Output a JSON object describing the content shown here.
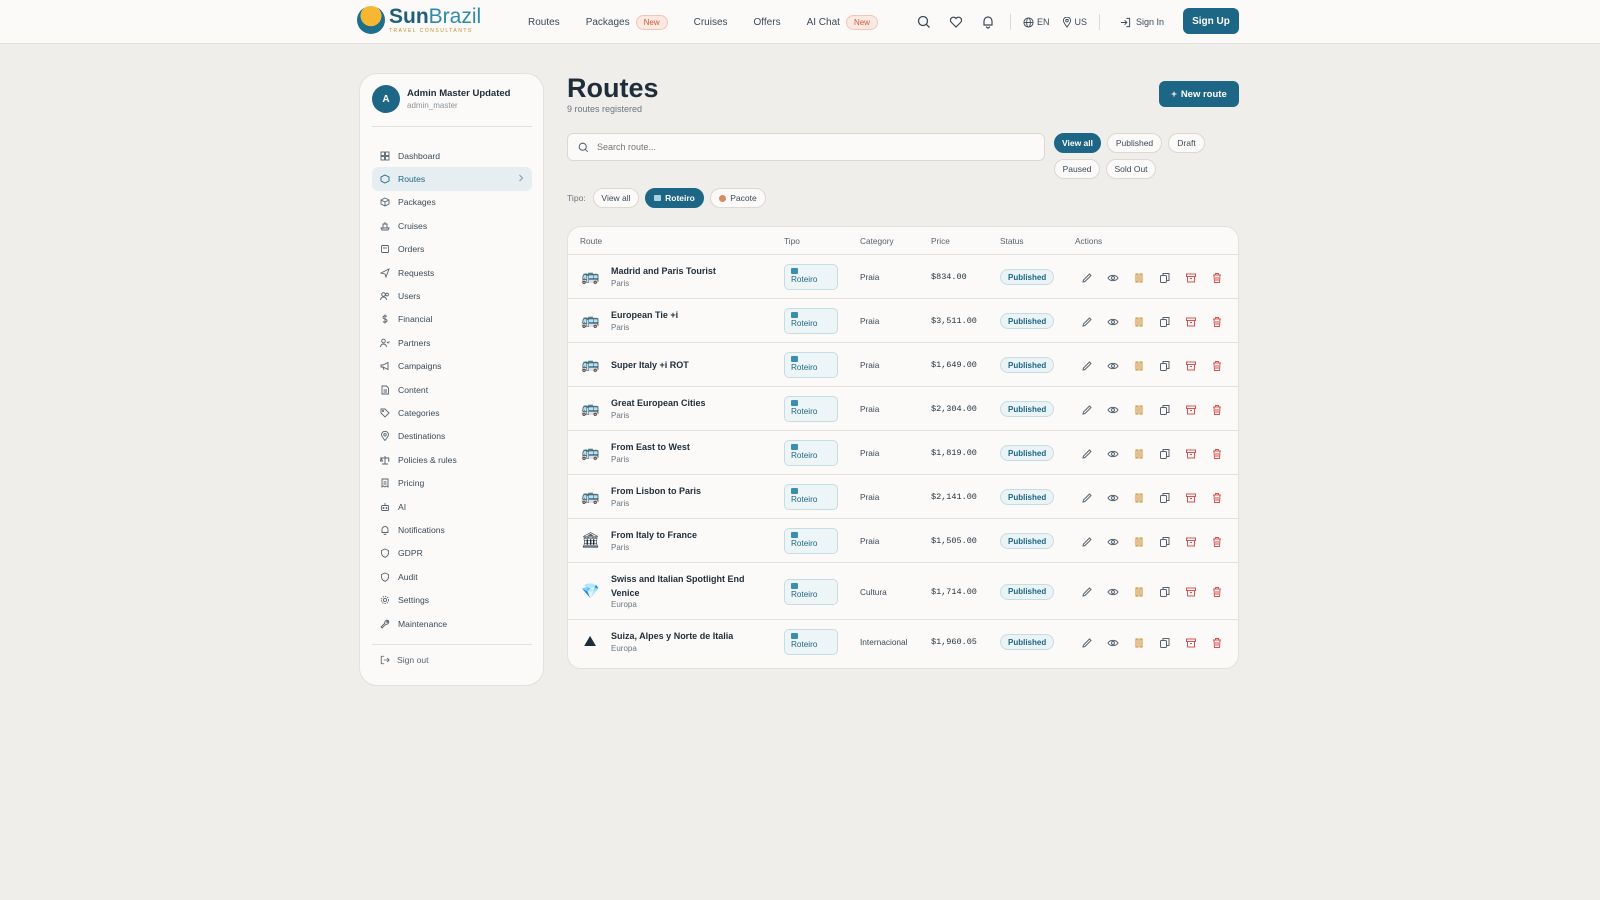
{
  "brand": {
    "name_a": "Sun",
    "name_b": "Brazil",
    "tagline": "TRAVEL CONSULTANTS"
  },
  "nav": {
    "links": [
      {
        "label": "Routes",
        "badge": ""
      },
      {
        "label": "Packages",
        "badge": "New"
      },
      {
        "label": "Cruises",
        "badge": ""
      },
      {
        "label": "Offers",
        "badge": ""
      },
      {
        "label": "AI Chat",
        "badge": "New"
      }
    ],
    "language": "EN",
    "region": "US",
    "signin": "Sign In",
    "signup": "Sign Up"
  },
  "user": {
    "initial": "A",
    "name": "Admin Master Updated",
    "handle": "admin_master"
  },
  "sidebar": {
    "items": [
      {
        "label": "Dashboard",
        "icon": "dashboard-icon"
      },
      {
        "label": "Routes",
        "icon": "routes-icon",
        "active": true
      },
      {
        "label": "Packages",
        "icon": "package-icon"
      },
      {
        "label": "Cruises",
        "icon": "ship-icon"
      },
      {
        "label": "Orders",
        "icon": "orders-icon"
      },
      {
        "label": "Requests",
        "icon": "send-icon"
      },
      {
        "label": "Users",
        "icon": "users-icon"
      },
      {
        "label": "Financial",
        "icon": "dollar-icon"
      },
      {
        "label": "Partners",
        "icon": "partners-icon"
      },
      {
        "label": "Campaigns",
        "icon": "megaphone-icon"
      },
      {
        "label": "Content",
        "icon": "document-icon"
      },
      {
        "label": "Categories",
        "icon": "tag-icon"
      },
      {
        "label": "Destinations",
        "icon": "pin-icon"
      },
      {
        "label": "Policies & rules",
        "icon": "scale-icon"
      },
      {
        "label": "Pricing",
        "icon": "receipt-icon"
      },
      {
        "label": "AI",
        "icon": "bot-icon"
      },
      {
        "label": "Notifications",
        "icon": "bell-icon"
      },
      {
        "label": "GDPR",
        "icon": "shield-icon"
      },
      {
        "label": "Audit",
        "icon": "shield-icon"
      },
      {
        "label": "Settings",
        "icon": "gear-icon"
      },
      {
        "label": "Maintenance",
        "icon": "wrench-icon"
      }
    ],
    "signout": "Sign out"
  },
  "page": {
    "title": "Routes",
    "subtitle": "9 routes registered",
    "new_button": "New route",
    "search_placeholder": "Search route...",
    "status_filters": [
      "View all",
      "Published",
      "Draft",
      "Paused",
      "Sold Out"
    ],
    "tipo_label": "Tipo:",
    "tipo_filters": [
      "View all",
      "Roteiro",
      "Pacote"
    ]
  },
  "table": {
    "headers": [
      "Route",
      "Tipo",
      "Category",
      "Price",
      "Status",
      "Actions"
    ],
    "rows": [
      {
        "emoji": "🚌",
        "name": "Madrid and Paris Tourist",
        "sub": "Paris",
        "tipo": "Roteiro",
        "category": "Praia",
        "price": "$834.00",
        "status": "Published"
      },
      {
        "emoji": "🚌",
        "name": "European Tie +i",
        "sub": "Paris",
        "tipo": "Roteiro",
        "category": "Praia",
        "price": "$3,511.00",
        "status": "Published"
      },
      {
        "emoji": "🚌",
        "name": "Super Italy +i ROT",
        "sub": "",
        "tipo": "Roteiro",
        "category": "Praia",
        "price": "$1,649.00",
        "status": "Published"
      },
      {
        "emoji": "🚌",
        "name": "Great European Cities",
        "sub": "Paris",
        "tipo": "Roteiro",
        "category": "Praia",
        "price": "$2,304.00",
        "status": "Published"
      },
      {
        "emoji": "🚌",
        "name": "From East to West",
        "sub": "Paris",
        "tipo": "Roteiro",
        "category": "Praia",
        "price": "$1,819.00",
        "status": "Published"
      },
      {
        "emoji": "🚌",
        "name": "From Lisbon to Paris",
        "sub": "Paris",
        "tipo": "Roteiro",
        "category": "Praia",
        "price": "$2,141.00",
        "status": "Published"
      },
      {
        "emoji": "🏛",
        "name": "From Italy to France",
        "sub": "Paris",
        "tipo": "Roteiro",
        "category": "Praia",
        "price": "$1,505.00",
        "status": "Published"
      },
      {
        "emoji": "💎",
        "name": "Swiss and Italian Spotlight End Venice",
        "sub": "Europa",
        "tipo": "Roteiro",
        "category": "Cultura",
        "price": "$1,714.00",
        "status": "Published"
      },
      {
        "emoji": "⛰",
        "name": "Suiza, Alpes y Norte de Italia",
        "sub": "Europa",
        "tipo": "Roteiro",
        "category": "Internacional",
        "price": "$1,960.05",
        "status": "Published"
      }
    ]
  },
  "colors": {
    "primary": "#1d6685",
    "accent": "#d45c3b",
    "background": "#f0eeea",
    "danger": "#d9534f",
    "gold": "#c98b2a"
  }
}
